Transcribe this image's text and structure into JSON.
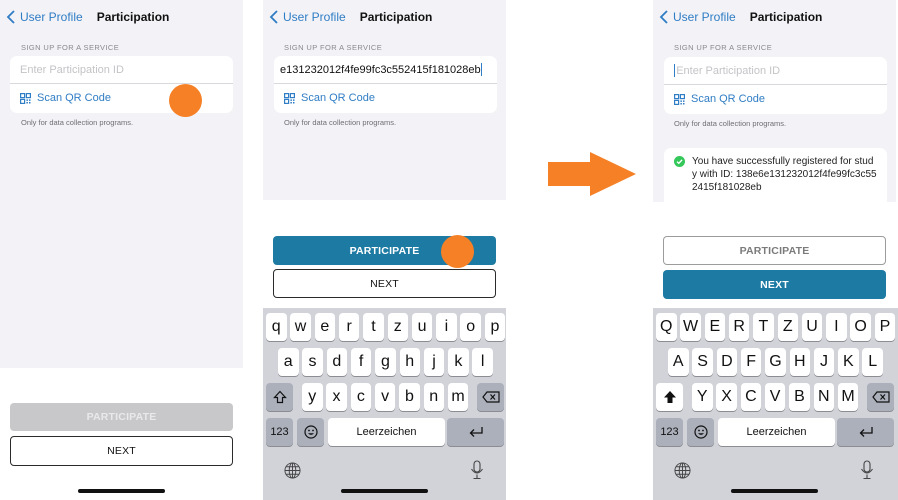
{
  "colors": {
    "accent": "#2f7dc4",
    "primary_button": "#1d7aa3",
    "tap_indicator": "#f58025",
    "success": "#34c759"
  },
  "screens": [
    {
      "nav": {
        "back_label": "User Profile",
        "title": "Participation"
      },
      "section_label": "SIGN UP FOR A SERVICE",
      "id_field": {
        "placeholder": "Enter Participation ID",
        "value": ""
      },
      "scan_label": "Scan QR Code",
      "hint": "Only for data collection programs.",
      "participate_label": "PARTICIPATE",
      "participate_state": "disabled",
      "next_label": "NEXT"
    },
    {
      "nav": {
        "back_label": "User Profile",
        "title": "Participation"
      },
      "section_label": "SIGN UP FOR A SERVICE",
      "id_field": {
        "placeholder": "Enter Participation ID",
        "value": "e131232012f4fe99fc3c552415f181028eb"
      },
      "scan_label": "Scan QR Code",
      "hint": "Only for data collection programs.",
      "participate_label": "PARTICIPATE",
      "participate_state": "enabled",
      "next_label": "NEXT",
      "keyboard": {
        "rows": [
          [
            "q",
            "w",
            "e",
            "r",
            "t",
            "z",
            "u",
            "i",
            "o",
            "p"
          ],
          [
            "a",
            "s",
            "d",
            "f",
            "g",
            "h",
            "j",
            "k",
            "l"
          ],
          [
            "y",
            "x",
            "c",
            "v",
            "b",
            "n",
            "m"
          ]
        ],
        "numbers_label": "123",
        "space_label": "Leerzeichen"
      }
    },
    {
      "nav": {
        "back_label": "User Profile",
        "title": "Participation"
      },
      "section_label": "SIGN UP FOR A SERVICE",
      "id_field": {
        "placeholder": "Enter Participation ID",
        "value": ""
      },
      "scan_label": "Scan QR Code",
      "hint": "Only for data collection programs.",
      "success_message": "You have successfully registered for study with ID: 138e6e131232012f4fe99fc3c552415f181028eb",
      "participate_label": "PARTICIPATE",
      "participate_state": "secondary",
      "next_label": "NEXT",
      "keyboard": {
        "rows": [
          [
            "Q",
            "W",
            "E",
            "R",
            "T",
            "Z",
            "U",
            "I",
            "O",
            "P"
          ],
          [
            "A",
            "S",
            "D",
            "F",
            "G",
            "H",
            "J",
            "K",
            "L"
          ],
          [
            "Y",
            "X",
            "C",
            "V",
            "B",
            "N",
            "M"
          ]
        ],
        "numbers_label": "123",
        "space_label": "Leerzeichen"
      }
    }
  ],
  "transition_arrow": "arrow-right-icon"
}
